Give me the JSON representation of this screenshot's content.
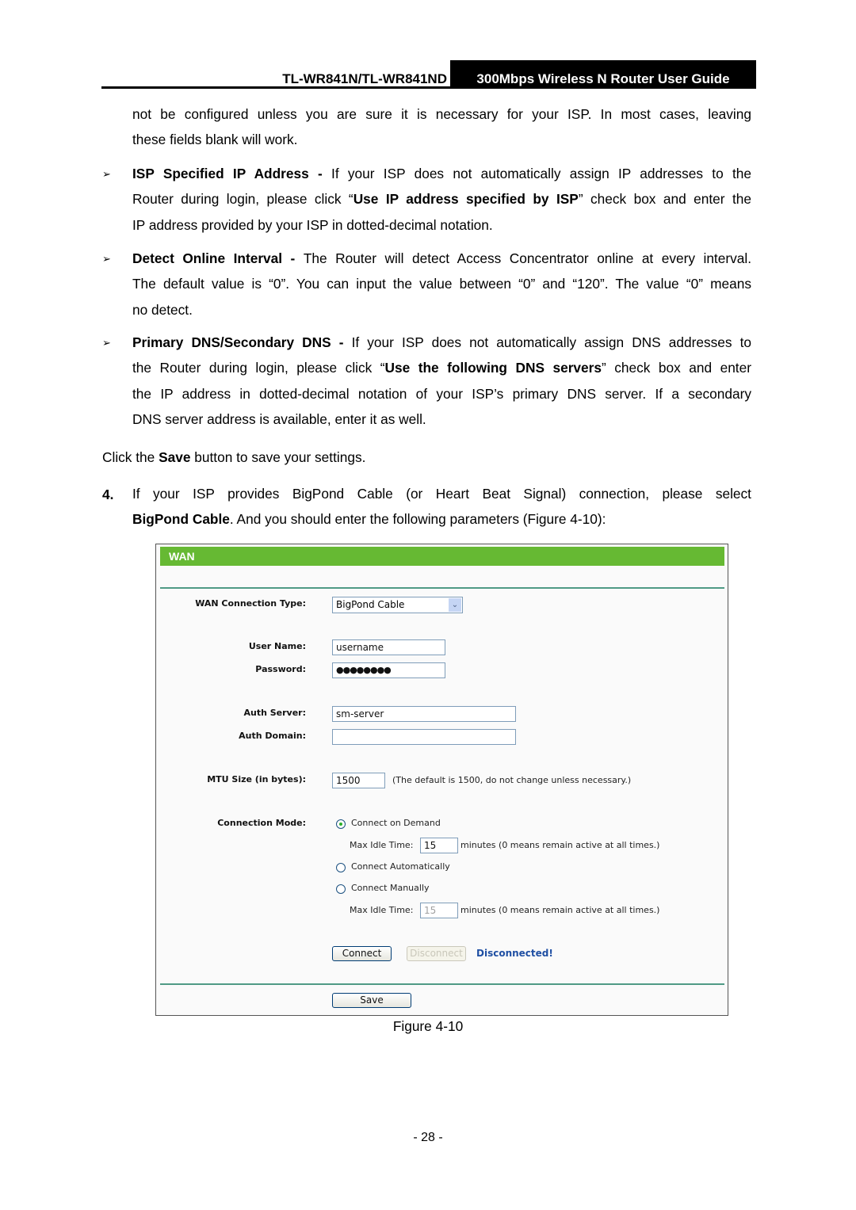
{
  "header": {
    "model": "TL-WR841N/TL-WR841ND",
    "guide_title": "300Mbps Wireless N Router User Guide"
  },
  "body": {
    "intro_line1": "not be configured unless you are sure it is necessary for your ISP. In most cases, leaving",
    "intro_line2": "these fields blank will work.",
    "bullets": [
      {
        "term": "ISP Specified IP Address - ",
        "line1": "If your ISP does not automatically assign IP addresses to the",
        "line2_pre": "Router during login, please click “",
        "line2_bold": "Use IP address specified by ISP",
        "line2_post": "” check box and enter the",
        "line3": "IP address provided by your ISP in dotted-decimal notation."
      },
      {
        "term": "Detect Online Interval - ",
        "line1": "The Router will detect Access Concentrator online at every interval.",
        "line2": "The default value is “0”. You can input the value between “0” and “120”. The value “0” means",
        "line3": "no detect."
      },
      {
        "term": "Primary DNS/Secondary DNS - ",
        "line1": "If your ISP does not automatically assign DNS addresses to",
        "line2_pre": "the Router during login, please click “",
        "line2_bold": "Use the following DNS servers",
        "line2_post": "” check box and enter",
        "line3": "the IP address in dotted-decimal notation of your ISP’s primary DNS server. If a secondary",
        "line4": "DNS server address is available, enter it as well."
      }
    ],
    "bullet_glyph": "➢",
    "save_note_pre": "Click the ",
    "save_note_bold": "Save",
    "save_note_post": " button to save your settings.",
    "step_number": "4.",
    "step_line1": "If your ISP provides BigPond Cable (or Heart Beat Signal) connection, please select",
    "step_line2_bold": "BigPond Cable",
    "step_line2_post": ". And you should enter the following parameters (Figure 4-10):"
  },
  "figure": {
    "panel_title": "WAN",
    "wan_type_label": "WAN Connection Type:",
    "wan_type_value": "BigPond Cable",
    "username_label": "User Name:",
    "username_value": "username",
    "password_label": "Password:",
    "password_value": "●●●●●●●●",
    "auth_server_label": "Auth Server:",
    "auth_server_value": "sm-server",
    "auth_domain_label": "Auth Domain:",
    "auth_domain_value": "",
    "mtu_label": "MTU Size (in bytes):",
    "mtu_value": "1500",
    "mtu_note": "(The default is 1500, do not change unless necessary.)",
    "connection_mode_label": "Connection Mode:",
    "modes": [
      {
        "label": "Connect on Demand",
        "selected": true
      },
      {
        "label": "Connect Automatically",
        "selected": false
      },
      {
        "label": "Connect Manually",
        "selected": false
      }
    ],
    "max_idle_label": "Max Idle Time:",
    "max_idle_demand_value": "15",
    "max_idle_manual_value": "15",
    "max_idle_note": "minutes (0 means remain active at all times.)",
    "connect_button": "Connect",
    "disconnect_button": "Disconnect",
    "status_text": "Disconnected!",
    "save_button": "Save",
    "accent_color": "#66b933"
  },
  "caption": "Figure 4-10",
  "page_number": "- 28 -"
}
